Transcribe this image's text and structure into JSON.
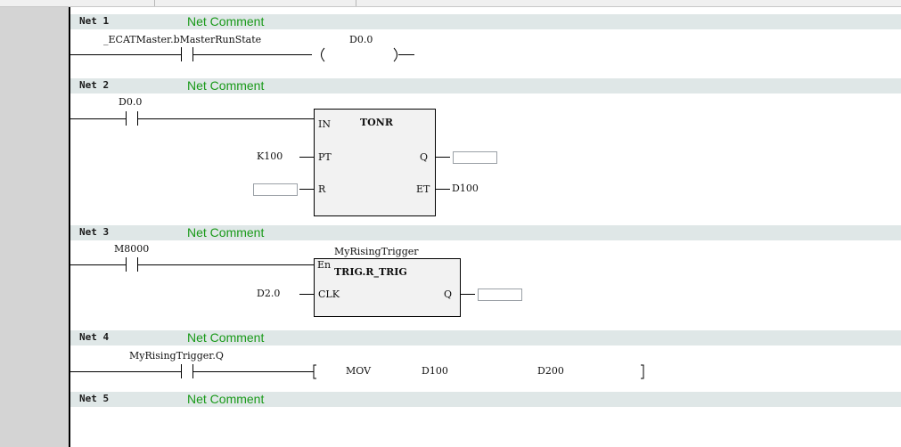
{
  "nets": [
    {
      "label": "Net 1",
      "comment": "Net Comment",
      "contact": "_ECATMaster.bMasterRunState",
      "coil": "D0.0"
    },
    {
      "label": "Net 2",
      "comment": "Net Comment",
      "contact": "D0.0",
      "block": {
        "name": "TONR",
        "in": "IN",
        "pt": "PT",
        "q": "Q",
        "r": "R",
        "et": "ET",
        "pt_value": "K100",
        "et_value": "D100"
      }
    },
    {
      "label": "Net 3",
      "comment": "Net Comment",
      "contact": "M8000",
      "instance": "MyRisingTrigger",
      "block": {
        "name": "TRIG.R_TRIG",
        "en": "En",
        "clk": "CLK",
        "q": "Q",
        "clk_value": "D2.0"
      }
    },
    {
      "label": "Net 4",
      "comment": "Net Comment",
      "contact": "MyRisingTrigger.Q",
      "instruction": {
        "op": "MOV",
        "src": "D100",
        "dst": "D200"
      }
    },
    {
      "label": "Net 5",
      "comment": "Net Comment"
    }
  ]
}
